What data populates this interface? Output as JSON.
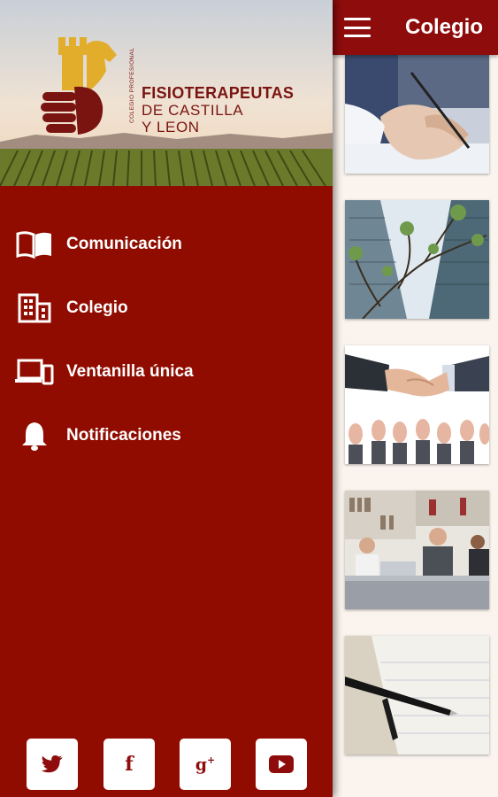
{
  "appbar": {
    "title": "Colegio",
    "menu_icon": "hamburger-icon"
  },
  "drawer": {
    "logo": {
      "vertical_text": "COLEGIO PROFESIONAL",
      "line1": "FISIOTERAPEUTAS",
      "line2": "DE CASTILLA",
      "line3": "Y LEON"
    },
    "menu": [
      {
        "label": "Comunicación",
        "icon": "book-icon"
      },
      {
        "label": "Colegio",
        "icon": "building-icon"
      },
      {
        "label": "Ventanilla única",
        "icon": "devices-icon"
      },
      {
        "label": "Notificaciones",
        "icon": "bell-icon"
      }
    ],
    "social": [
      {
        "name": "twitter",
        "icon": "twitter-icon"
      },
      {
        "name": "facebook",
        "icon": "facebook-icon"
      },
      {
        "name": "google-plus",
        "icon": "google-plus-icon"
      },
      {
        "name": "youtube",
        "icon": "youtube-icon"
      }
    ]
  },
  "cards": [
    {
      "image": "writing-hand-image"
    },
    {
      "image": "buildings-tree-image"
    },
    {
      "image": "handshake-image"
    },
    {
      "image": "office-meeting-image"
    },
    {
      "image": "pen-document-image"
    }
  ],
  "colors": {
    "primary": "#8e0c0c",
    "drawer": "#900c00",
    "content_bg": "#fbf4ee",
    "logo_gold": "#e2ad2b",
    "logo_red": "#7a1410"
  }
}
